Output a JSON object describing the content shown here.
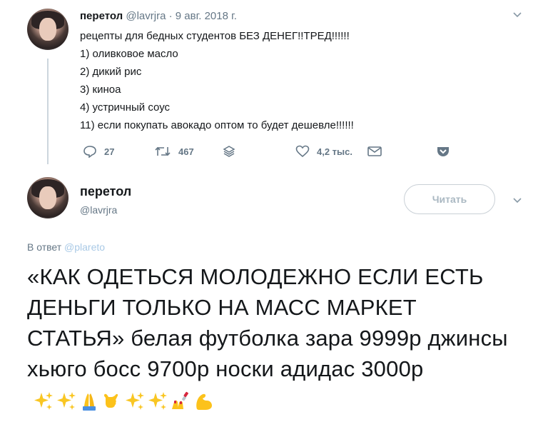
{
  "tweet1": {
    "author_name": "перетол",
    "handle": "@lavrjra",
    "dot": "·",
    "date": "9 авг. 2018 г.",
    "lines": [
      "рецепты для бедных студентов БЕЗ ДЕНЕГ!!ТРЕД!!!!!!",
      "1) оливковое масло",
      "2) дикий рис",
      "3) киноа",
      "4) устричный соус",
      "11) если покупать авокадо оптом то будет дешевле!!!!!!"
    ],
    "actions": {
      "replies": "27",
      "retweets": "467",
      "likes": "4,2 тыс."
    },
    "menu_icon": "chevron-down-icon"
  },
  "tweet2": {
    "author_name": "перетол",
    "handle": "@lavrjra",
    "follow_label": "Читать",
    "reply_prefix": "В ответ",
    "reply_mention": "@plareto",
    "text": "«КАК ОДЕТЬСЯ МОЛОДЕЖНО ЕСЛИ ЕСТЬ ДЕНЬГИ ТОЛЬКО НА МАСС МАРКЕТ СТАТЬЯ» белая футболка зара 9999р джинсы хьюго босс 9700р носки адидас 3000р",
    "emojis": [
      "sparkles-icon",
      "sparkles-icon",
      "folded-hands-icon",
      "call-me-hand-icon",
      "sparkles-icon",
      "sparkles-icon",
      "nail-polish-icon",
      "flexed-biceps-icon"
    ]
  },
  "colors": {
    "text": "#14171a",
    "secondary": "#657786",
    "link": "#a9c9e6",
    "thread_line": "#ccd6dd",
    "button_border": "#c9d0d6"
  }
}
